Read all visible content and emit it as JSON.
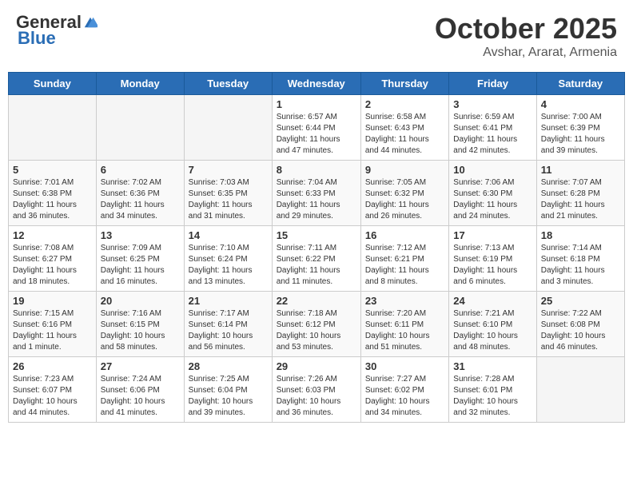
{
  "header": {
    "logo_general": "General",
    "logo_blue": "Blue",
    "month": "October 2025",
    "location": "Avshar, Ararat, Armenia"
  },
  "days_of_week": [
    "Sunday",
    "Monday",
    "Tuesday",
    "Wednesday",
    "Thursday",
    "Friday",
    "Saturday"
  ],
  "weeks": [
    [
      {
        "day": "",
        "info": ""
      },
      {
        "day": "",
        "info": ""
      },
      {
        "day": "",
        "info": ""
      },
      {
        "day": "1",
        "info": "Sunrise: 6:57 AM\nSunset: 6:44 PM\nDaylight: 11 hours\nand 47 minutes."
      },
      {
        "day": "2",
        "info": "Sunrise: 6:58 AM\nSunset: 6:43 PM\nDaylight: 11 hours\nand 44 minutes."
      },
      {
        "day": "3",
        "info": "Sunrise: 6:59 AM\nSunset: 6:41 PM\nDaylight: 11 hours\nand 42 minutes."
      },
      {
        "day": "4",
        "info": "Sunrise: 7:00 AM\nSunset: 6:39 PM\nDaylight: 11 hours\nand 39 minutes."
      }
    ],
    [
      {
        "day": "5",
        "info": "Sunrise: 7:01 AM\nSunset: 6:38 PM\nDaylight: 11 hours\nand 36 minutes."
      },
      {
        "day": "6",
        "info": "Sunrise: 7:02 AM\nSunset: 6:36 PM\nDaylight: 11 hours\nand 34 minutes."
      },
      {
        "day": "7",
        "info": "Sunrise: 7:03 AM\nSunset: 6:35 PM\nDaylight: 11 hours\nand 31 minutes."
      },
      {
        "day": "8",
        "info": "Sunrise: 7:04 AM\nSunset: 6:33 PM\nDaylight: 11 hours\nand 29 minutes."
      },
      {
        "day": "9",
        "info": "Sunrise: 7:05 AM\nSunset: 6:32 PM\nDaylight: 11 hours\nand 26 minutes."
      },
      {
        "day": "10",
        "info": "Sunrise: 7:06 AM\nSunset: 6:30 PM\nDaylight: 11 hours\nand 24 minutes."
      },
      {
        "day": "11",
        "info": "Sunrise: 7:07 AM\nSunset: 6:28 PM\nDaylight: 11 hours\nand 21 minutes."
      }
    ],
    [
      {
        "day": "12",
        "info": "Sunrise: 7:08 AM\nSunset: 6:27 PM\nDaylight: 11 hours\nand 18 minutes."
      },
      {
        "day": "13",
        "info": "Sunrise: 7:09 AM\nSunset: 6:25 PM\nDaylight: 11 hours\nand 16 minutes."
      },
      {
        "day": "14",
        "info": "Sunrise: 7:10 AM\nSunset: 6:24 PM\nDaylight: 11 hours\nand 13 minutes."
      },
      {
        "day": "15",
        "info": "Sunrise: 7:11 AM\nSunset: 6:22 PM\nDaylight: 11 hours\nand 11 minutes."
      },
      {
        "day": "16",
        "info": "Sunrise: 7:12 AM\nSunset: 6:21 PM\nDaylight: 11 hours\nand 8 minutes."
      },
      {
        "day": "17",
        "info": "Sunrise: 7:13 AM\nSunset: 6:19 PM\nDaylight: 11 hours\nand 6 minutes."
      },
      {
        "day": "18",
        "info": "Sunrise: 7:14 AM\nSunset: 6:18 PM\nDaylight: 11 hours\nand 3 minutes."
      }
    ],
    [
      {
        "day": "19",
        "info": "Sunrise: 7:15 AM\nSunset: 6:16 PM\nDaylight: 11 hours\nand 1 minute."
      },
      {
        "day": "20",
        "info": "Sunrise: 7:16 AM\nSunset: 6:15 PM\nDaylight: 10 hours\nand 58 minutes."
      },
      {
        "day": "21",
        "info": "Sunrise: 7:17 AM\nSunset: 6:14 PM\nDaylight: 10 hours\nand 56 minutes."
      },
      {
        "day": "22",
        "info": "Sunrise: 7:18 AM\nSunset: 6:12 PM\nDaylight: 10 hours\nand 53 minutes."
      },
      {
        "day": "23",
        "info": "Sunrise: 7:20 AM\nSunset: 6:11 PM\nDaylight: 10 hours\nand 51 minutes."
      },
      {
        "day": "24",
        "info": "Sunrise: 7:21 AM\nSunset: 6:10 PM\nDaylight: 10 hours\nand 48 minutes."
      },
      {
        "day": "25",
        "info": "Sunrise: 7:22 AM\nSunset: 6:08 PM\nDaylight: 10 hours\nand 46 minutes."
      }
    ],
    [
      {
        "day": "26",
        "info": "Sunrise: 7:23 AM\nSunset: 6:07 PM\nDaylight: 10 hours\nand 44 minutes."
      },
      {
        "day": "27",
        "info": "Sunrise: 7:24 AM\nSunset: 6:06 PM\nDaylight: 10 hours\nand 41 minutes."
      },
      {
        "day": "28",
        "info": "Sunrise: 7:25 AM\nSunset: 6:04 PM\nDaylight: 10 hours\nand 39 minutes."
      },
      {
        "day": "29",
        "info": "Sunrise: 7:26 AM\nSunset: 6:03 PM\nDaylight: 10 hours\nand 36 minutes."
      },
      {
        "day": "30",
        "info": "Sunrise: 7:27 AM\nSunset: 6:02 PM\nDaylight: 10 hours\nand 34 minutes."
      },
      {
        "day": "31",
        "info": "Sunrise: 7:28 AM\nSunset: 6:01 PM\nDaylight: 10 hours\nand 32 minutes."
      },
      {
        "day": "",
        "info": ""
      }
    ]
  ]
}
